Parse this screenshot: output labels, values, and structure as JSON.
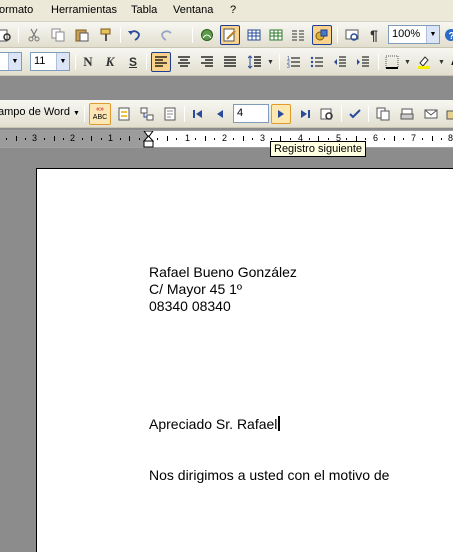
{
  "menu": {
    "items": [
      "ormato",
      "Herramientas",
      "Tabla",
      "Ventana",
      "?"
    ]
  },
  "toolbar_standard": {
    "zoom_value": "100%"
  },
  "toolbar_formatting": {
    "font_size": "11",
    "bold": "N",
    "italic": "K",
    "underline": "S"
  },
  "toolbar_mailmerge": {
    "insert_field_label": "ampo de Word",
    "merge_field_icon_text": "«»\nABC",
    "record_number": "4"
  },
  "ruler": {
    "numbers": [
      "3",
      "2",
      "1",
      "1",
      "2",
      "3",
      "4",
      "5",
      "6",
      "7",
      "8"
    ]
  },
  "tooltip": "Registro siguiente",
  "document": {
    "lines": [
      "Rafael Bueno González",
      "C/ Mayor 45 1º",
      "08340 08340",
      "Apreciado Sr. Rafael",
      "Nos dirigimos a usted con el motivo de"
    ]
  }
}
